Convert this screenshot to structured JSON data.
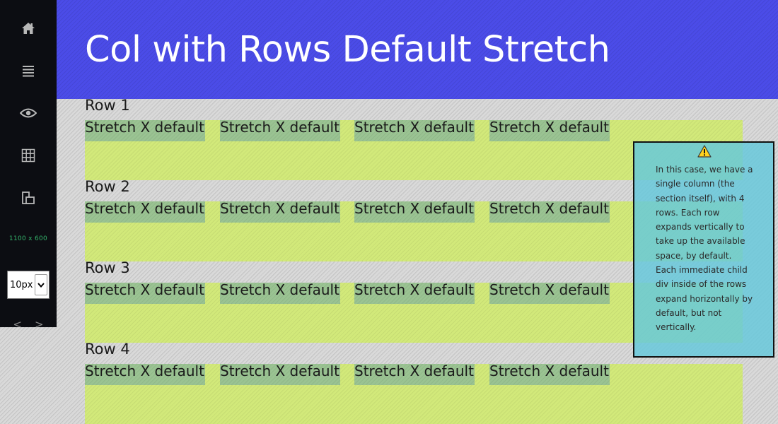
{
  "header": {
    "title": "Col with Rows Default Stretch"
  },
  "sidebar": {
    "icons": [
      "home-icon",
      "menu-icon",
      "eye-icon",
      "grid-icon",
      "layout-icon"
    ],
    "dimensions": "1100 x 600",
    "gap_select": {
      "value": "10px"
    },
    "prev_arrow": "<",
    "next_arrow": ">"
  },
  "rows": [
    {
      "label": "Row 1",
      "cells": [
        "Stretch X default",
        "Stretch X default",
        "Stretch X default",
        "Stretch X default"
      ]
    },
    {
      "label": "Row 2",
      "cells": [
        "Stretch X default",
        "Stretch X default",
        "Stretch X default",
        "Stretch X default"
      ]
    },
    {
      "label": "Row 3",
      "cells": [
        "Stretch X default",
        "Stretch X default",
        "Stretch X default",
        "Stretch X default"
      ]
    },
    {
      "label": "Row 4",
      "cells": [
        "Stretch X default",
        "Stretch X default",
        "Stretch X default",
        "Stretch X default"
      ]
    }
  ],
  "info": {
    "icon": "warning-icon",
    "text": "In this case, we have a single column (the section itself), with 4 rows. Each row expands vertically to take up the available space, by default. Each immediate child div inside of the rows expand horizontally by default, but not vertically."
  },
  "colors": {
    "header_bg": "#4b4ce8",
    "sidebar_bg": "#0c0d12",
    "row_bg": "#d2e97a",
    "cell_bg": "#9ac392",
    "info_bg": "#64c8dc",
    "dims_text": "#34b36b"
  }
}
